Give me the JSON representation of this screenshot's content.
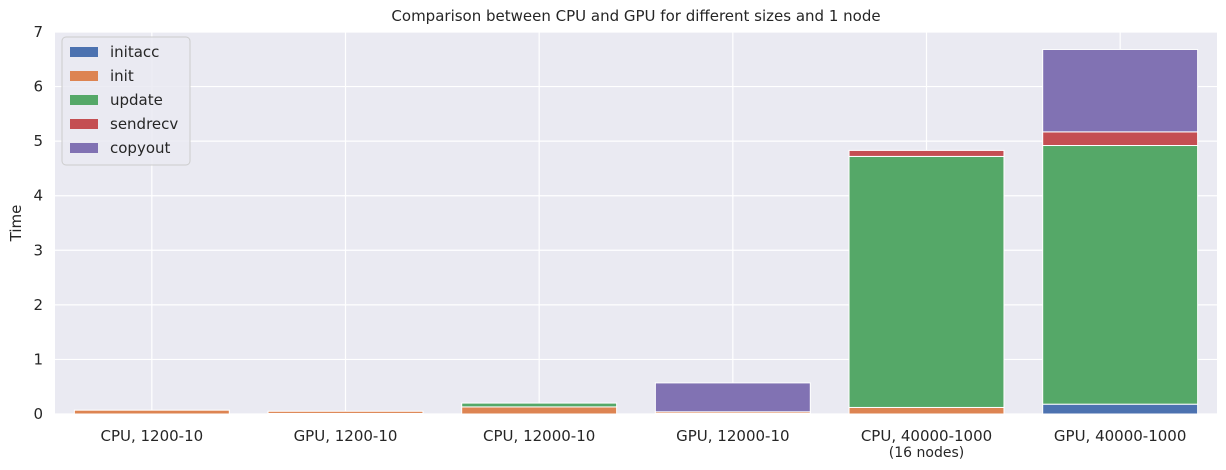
{
  "chart_data": {
    "type": "bar",
    "stacked": true,
    "title": "Comparison between CPU and GPU for different sizes and 1 node",
    "xlabel": "",
    "ylabel": "Time",
    "ylim": [
      0,
      7
    ],
    "yticks": [
      "0",
      "1",
      "2",
      "3",
      "4",
      "5",
      "6",
      "7"
    ],
    "grid": true,
    "legend_position": "top-left",
    "categories": [
      [
        "CPU, 1200-10"
      ],
      [
        "GPU, 1200-10"
      ],
      [
        "CPU, 12000-10"
      ],
      [
        "GPU, 12000-10"
      ],
      [
        "CPU, 40000-1000",
        "(16 nodes)"
      ],
      [
        "GPU, 40000-1000"
      ]
    ],
    "series": [
      {
        "name": "initacc",
        "color": "#4c72b0",
        "values": [
          0,
          0.01,
          0,
          0.01,
          0,
          0.18
        ]
      },
      {
        "name": "init",
        "color": "#dd8452",
        "values": [
          0.07,
          0.04,
          0.13,
          0.03,
          0.12,
          0.0
        ]
      },
      {
        "name": "update",
        "color": "#55a868",
        "values": [
          0.0,
          0.0,
          0.07,
          0.0,
          4.6,
          4.74
        ]
      },
      {
        "name": "sendrecv",
        "color": "#c44e52",
        "values": [
          0,
          0,
          0,
          0,
          0.11,
          0.25
        ]
      },
      {
        "name": "copyout",
        "color": "#8172b3",
        "values": [
          0,
          0,
          0,
          0.53,
          0,
          1.51
        ]
      }
    ]
  }
}
